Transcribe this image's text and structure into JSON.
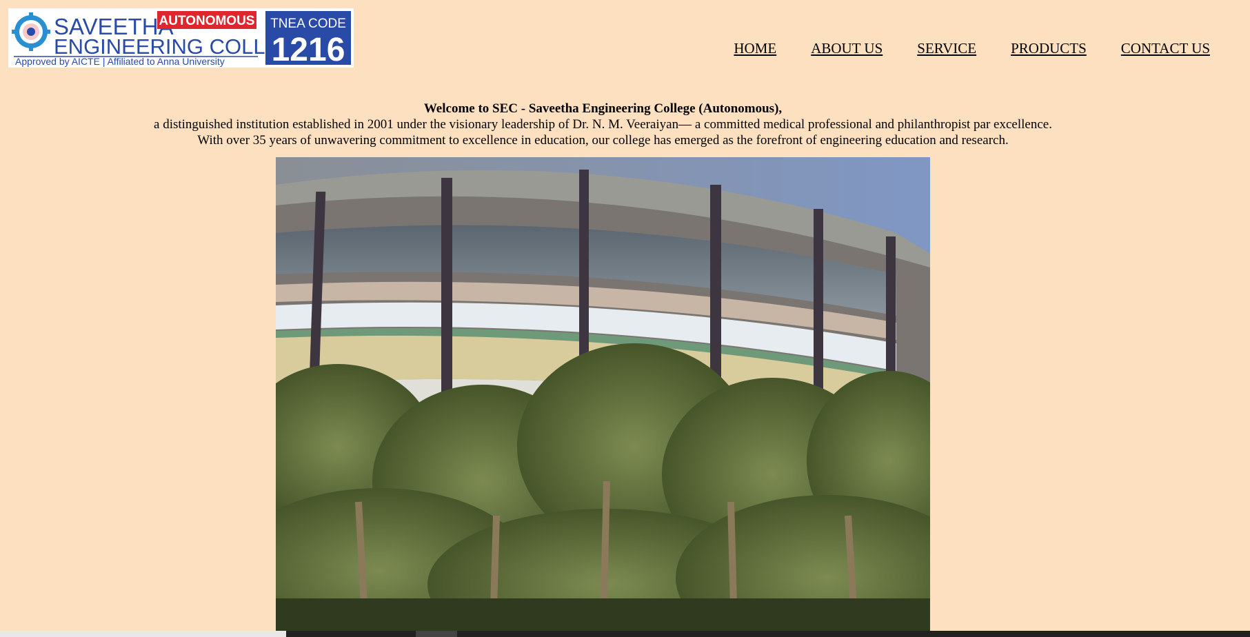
{
  "logo": {
    "name_line1": "SAVEETHA",
    "name_line2": "ENGINEERING COLLEGE",
    "badge": "AUTONOMOUS",
    "tagline": "Approved by AICTE  |  Affiliated to Anna University",
    "tnea_label": "TNEA CODE",
    "tnea_code": "1216",
    "colors": {
      "blue": "#2a4aa8",
      "red": "#e0262d",
      "white": "#ffffff"
    }
  },
  "nav": {
    "items": [
      {
        "label": "HOME"
      },
      {
        "label": "ABOUT US"
      },
      {
        "label": "SERVICE"
      },
      {
        "label": "PRODUCTS"
      },
      {
        "label": "CONTACT US"
      }
    ]
  },
  "welcome": {
    "headline": "Welcome to SEC - Saveetha Engineering College (Autonomous),",
    "line2": "a distinguished institution established in 2001 under the visionary leadership of Dr. N. M. Veeraiyan— a committed medical professional and philanthropist par excellence.",
    "line3": "With over 35 years of unwavering commitment to excellence in education, our college has emerged as the forefront of engineering education and research."
  },
  "theme": {
    "background": "#fde0bf"
  }
}
